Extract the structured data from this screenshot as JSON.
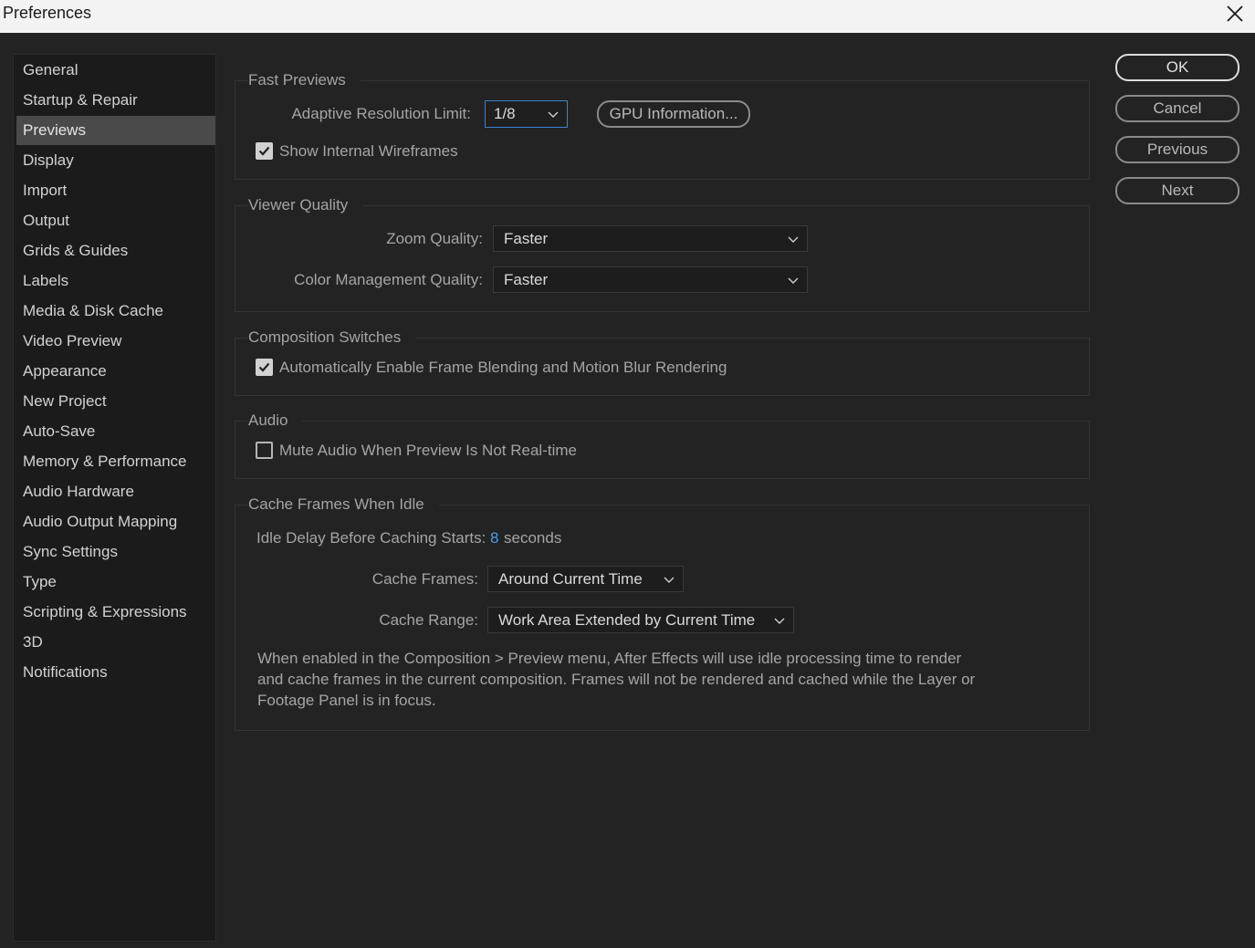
{
  "window": {
    "title": "Preferences",
    "close_icon": "close-icon"
  },
  "sidebar": {
    "selected": "Previews",
    "items": [
      {
        "label": "General"
      },
      {
        "label": "Startup & Repair"
      },
      {
        "label": "Previews"
      },
      {
        "label": "Display"
      },
      {
        "label": "Import"
      },
      {
        "label": "Output"
      },
      {
        "label": "Grids & Guides"
      },
      {
        "label": "Labels"
      },
      {
        "label": "Media & Disk Cache"
      },
      {
        "label": "Video Preview"
      },
      {
        "label": "Appearance"
      },
      {
        "label": "New Project"
      },
      {
        "label": "Auto-Save"
      },
      {
        "label": "Memory & Performance"
      },
      {
        "label": "Audio Hardware"
      },
      {
        "label": "Audio Output Mapping"
      },
      {
        "label": "Sync Settings"
      },
      {
        "label": "Type"
      },
      {
        "label": "Scripting & Expressions"
      },
      {
        "label": "3D"
      },
      {
        "label": "Notifications"
      }
    ]
  },
  "fast_previews": {
    "title": "Fast Previews",
    "adaptive_label": "Adaptive Resolution Limit:",
    "adaptive_value": "1/8",
    "gpu_button": "GPU Information...",
    "wireframes_label": "Show Internal Wireframes",
    "wireframes_checked": true
  },
  "viewer_quality": {
    "title": "Viewer Quality",
    "zoom_label": "Zoom Quality:",
    "zoom_value": "Faster",
    "color_label": "Color Management Quality:",
    "color_value": "Faster"
  },
  "composition_switches": {
    "title": "Composition Switches",
    "frame_blending_label": "Automatically Enable Frame Blending and Motion Blur Rendering",
    "frame_blending_checked": true
  },
  "audio": {
    "title": "Audio",
    "mute_label": "Mute Audio When Preview Is Not Real-time",
    "mute_checked": false
  },
  "cache_idle": {
    "title": "Cache Frames When Idle",
    "delay_label": "Idle Delay Before Caching Starts:",
    "delay_value": "8",
    "delay_unit": "seconds",
    "frames_label": "Cache Frames:",
    "frames_value": "Around Current Time",
    "range_label": "Cache Range:",
    "range_value": "Work Area Extended by Current Time",
    "description": "When enabled in the Composition > Preview menu, After Effects will use idle processing time to render and cache frames in the current composition. Frames will not be rendered and cached while the Layer or Footage Panel is in focus."
  },
  "buttons": {
    "ok": "OK",
    "cancel": "Cancel",
    "previous": "Previous",
    "next": "Next"
  },
  "colors": {
    "background": "#232323",
    "sidebar_selected": "#4a4a4a",
    "accent_blue": "#3a83d2"
  }
}
